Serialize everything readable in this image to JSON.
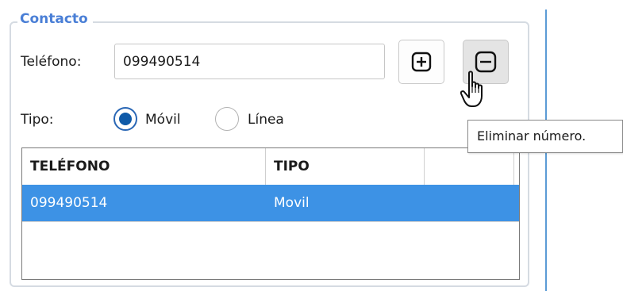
{
  "group": {
    "title": "Contacto"
  },
  "phone": {
    "label": "Teléfono:",
    "value": "099490514"
  },
  "actions": {
    "add_symbol": "⊞",
    "remove_symbol": "⊟"
  },
  "type": {
    "label": "Tipo:",
    "options": [
      {
        "label": "Móvil",
        "checked": true
      },
      {
        "label": "Línea",
        "checked": false
      }
    ]
  },
  "tooltip": {
    "text": "Eliminar número."
  },
  "table": {
    "columns": [
      "TELÉFONO",
      "TIPO",
      ""
    ],
    "rows": [
      {
        "telefono": "099490514",
        "tipo": "Movil",
        "selected": true
      }
    ]
  },
  "colors": {
    "accent": "#4a7fd6",
    "selection": "#3d92e5",
    "radio_fill": "#0f5aa8",
    "divider": "#5b9bd5"
  },
  "icons": [
    "plus-square-icon",
    "minus-square-icon",
    "hand-pointer-icon"
  ]
}
